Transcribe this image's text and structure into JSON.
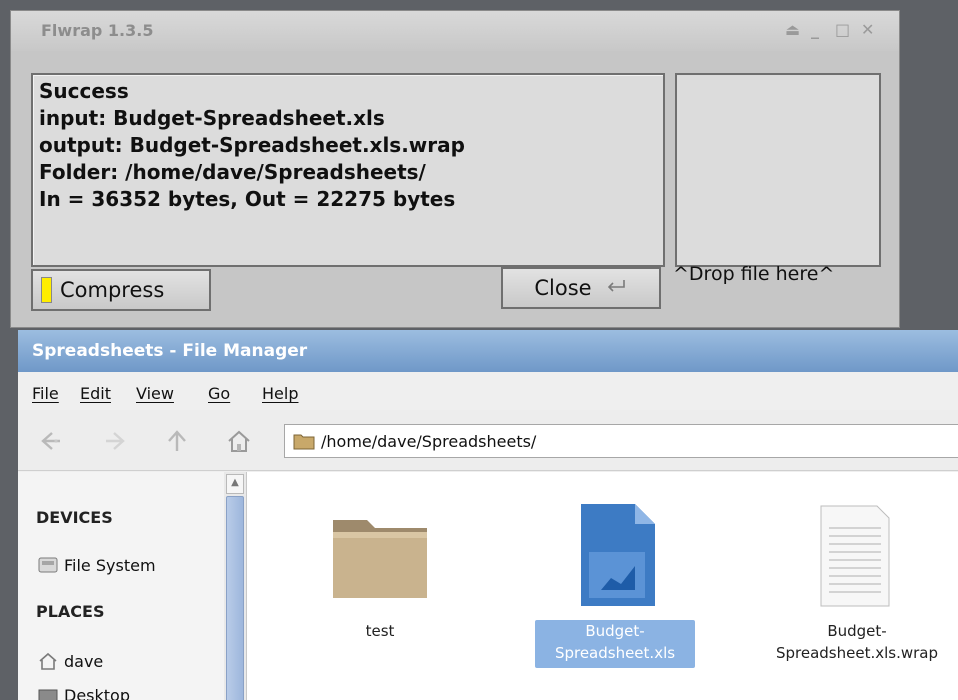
{
  "flwrap": {
    "title": "Flwrap 1.3.5",
    "window_controls": {
      "eject": "⏏",
      "minimize": "_",
      "maximize": "□",
      "close": "✕"
    },
    "message_lines": [
      "Success",
      "input: Budget-Spreadsheet.xls",
      "output: Budget-Spreadsheet.xls.wrap",
      "Folder: /home/dave/Spreadsheets/",
      "In = 36352 bytes, Out = 22275 bytes"
    ],
    "drop_label": "^Drop file here^",
    "compress_label": "Compress",
    "close_label": "Close",
    "close_icon": "return-icon",
    "led_color": "#ffee00"
  },
  "file_manager": {
    "title": "Spreadsheets - File Manager",
    "menu": [
      "File",
      "Edit",
      "View",
      "Go",
      "Help"
    ],
    "toolbar": [
      "back-icon",
      "forward-icon",
      "up-icon",
      "home-icon"
    ],
    "path": "/home/dave/Spreadsheets/",
    "sidebar": {
      "devices_heading": "DEVICES",
      "devices": [
        {
          "label": "File System",
          "icon": "drive-icon"
        }
      ],
      "places_heading": "PLACES",
      "places": [
        {
          "label": "dave",
          "icon": "home-icon"
        },
        {
          "label": "Desktop",
          "icon": "desktop-icon"
        }
      ]
    },
    "files": [
      {
        "name_line1": "test",
        "name_line2": "",
        "icon": "folder-icon",
        "selected": false
      },
      {
        "name_line1": "Budget-",
        "name_line2": "Spreadsheet.xls",
        "icon": "spreadsheet-icon",
        "selected": true
      },
      {
        "name_line1": "Budget-",
        "name_line2": "Spreadsheet.xls.wrap",
        "icon": "text-file-icon",
        "selected": false
      }
    ],
    "selection_color": "#8bb3e3",
    "title_bar_color": "#7ea6d2"
  }
}
